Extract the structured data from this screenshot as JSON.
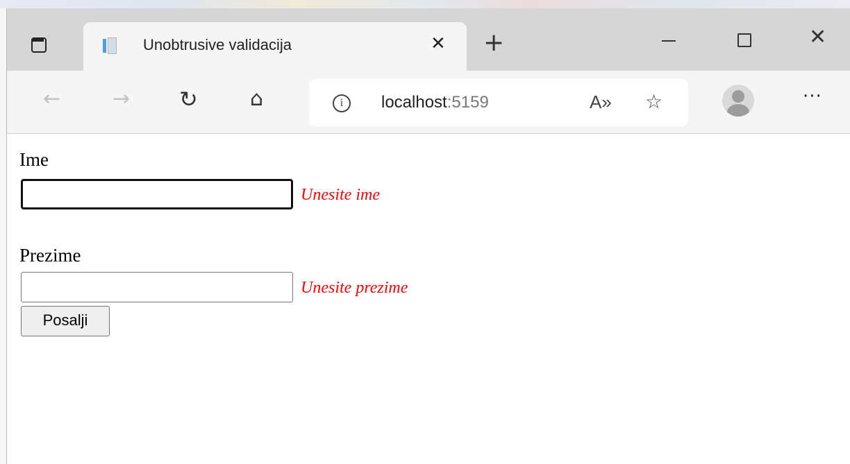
{
  "browser": {
    "tab": {
      "title": "Unobtrusive validacija",
      "close_glyph": "✕"
    },
    "new_tab_glyph": "+",
    "window_controls": {
      "minimize": "minimize-icon",
      "maximize": "maximize-icon",
      "close_glyph": "✕"
    },
    "nav": {
      "back_glyph": "←",
      "forward_glyph": "→",
      "reload_glyph": "↻",
      "home_glyph": "⌂"
    },
    "address": {
      "host": "localhost",
      "port": ":5159",
      "info_glyph": "i"
    },
    "read_aloud_glyph": "A»",
    "favorites_glyph": "☆",
    "more_glyph": "···"
  },
  "form": {
    "ime_label": "Ime",
    "ime_value": "",
    "ime_error": "Unesite ime",
    "prezime_label": "Prezime",
    "prezime_value": "",
    "prezime_error": "Unesite prezime",
    "submit_label": "Posalji"
  },
  "colors": {
    "error": "#ff0000",
    "tabbar": "#d6d6d6",
    "toolbar": "#f5f5f5"
  }
}
